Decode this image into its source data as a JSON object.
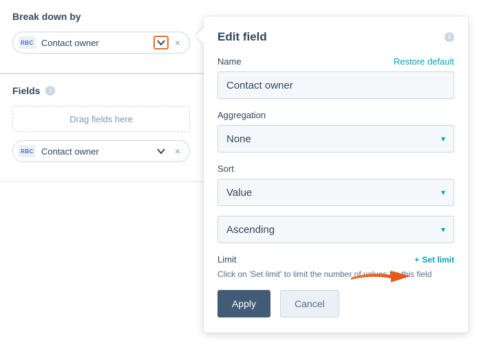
{
  "left": {
    "breakdown": {
      "title": "Break down by",
      "chip": {
        "badge": "RBC",
        "label": "Contact owner"
      }
    },
    "fields": {
      "title": "Fields",
      "dropzone": "Drag fields here",
      "chip": {
        "badge": "RBC",
        "label": "Contact owner"
      }
    }
  },
  "popover": {
    "title": "Edit field",
    "name": {
      "label": "Name",
      "value": "Contact owner",
      "restore": "Restore default"
    },
    "aggregation": {
      "label": "Aggregation",
      "value": "None"
    },
    "sort": {
      "label": "Sort",
      "value": "Value",
      "direction": "Ascending"
    },
    "limit": {
      "label": "Limit",
      "set": "Set limit",
      "help": "Click on 'Set limit' to limit the number of values for this field"
    },
    "buttons": {
      "apply": "Apply",
      "cancel": "Cancel"
    }
  },
  "icons": {
    "info": "i",
    "plus": "+",
    "close": "×",
    "chevdown": "▾"
  }
}
